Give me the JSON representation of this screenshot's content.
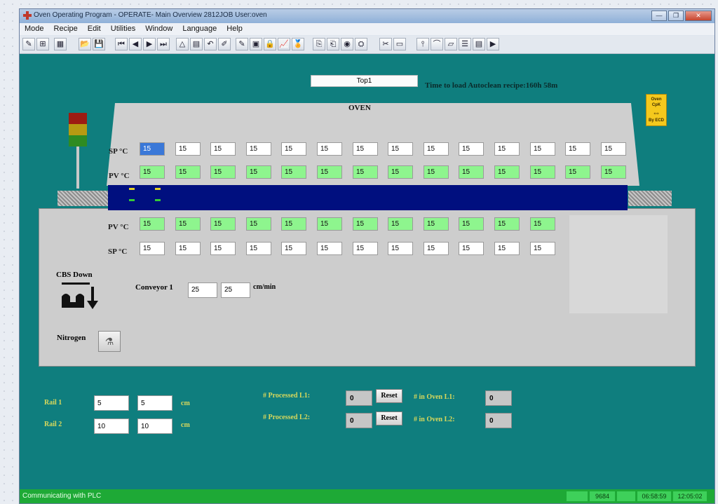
{
  "window": {
    "title": "Oven Operating Program - OPERATE- Main Overview 2812JOB User:oven",
    "buttons": [
      "—",
      "❐",
      "✕"
    ]
  },
  "menu": [
    "Mode",
    "Recipe",
    "Edit",
    "Utilities",
    "Window",
    "Language",
    "Help"
  ],
  "toolbar": {
    "icons": [
      "edit-icon",
      "grid-icon",
      "zones-icon",
      "open-folder-icon",
      "save-icon",
      "first-icon",
      "prev-icon",
      "next-icon",
      "last-icon",
      "triangle-icon",
      "profile-icon",
      "undo-icon",
      "draw-icon",
      "pen-icon",
      "box-icon",
      "lock-icon",
      "graph-icon",
      "certificate-icon",
      "copy-icon",
      "paste-icon",
      "wheel-icon",
      "camera-icon",
      "cut-icon",
      "window-icon",
      "probe-icon",
      "measure-icon",
      "tape-icon",
      "list-icon",
      "monitor-icon",
      "play-icon"
    ],
    "glyphs": [
      "✎",
      "⊞",
      "▦",
      "📂",
      "💾",
      "⏮",
      "◀",
      "▶",
      "⏭",
      "△",
      "▤",
      "↶",
      "✐",
      "✎",
      "▣",
      "🔒",
      "📈",
      "🏅",
      "⎘",
      "⎗",
      "◉",
      "⛭",
      "✂",
      "▭",
      "⫯",
      "⌒",
      "▱",
      "☰",
      "▤",
      "▶"
    ]
  },
  "header": {
    "top_field": "Top1",
    "autoclean": "Time to load Autoclean recipe:160h 58m",
    "cpk_badge": [
      "Oven CpK",
      "⇔",
      "By ECD"
    ]
  },
  "oven": {
    "label": "OVEN",
    "upper_sp_label": "SP °C",
    "upper_pv_label": "PV °C",
    "lower_pv_label": "PV °C",
    "lower_sp_label": "SP °C",
    "upper_sp": [
      "15",
      "15",
      "15",
      "15",
      "15",
      "15",
      "15",
      "15",
      "15",
      "15",
      "15",
      "15",
      "15",
      "15"
    ],
    "upper_pv": [
      "15",
      "15",
      "15",
      "15",
      "15",
      "15",
      "15",
      "15",
      "15",
      "15",
      "15",
      "15",
      "15",
      "15"
    ],
    "lower_pv": [
      "15",
      "15",
      "15",
      "15",
      "15",
      "15",
      "15",
      "15",
      "15",
      "15",
      "15",
      "15"
    ],
    "lower_sp": [
      "15",
      "15",
      "15",
      "15",
      "15",
      "15",
      "15",
      "15",
      "15",
      "15",
      "15",
      "15"
    ]
  },
  "controls": {
    "cbs_label": "CBS Down",
    "conveyor_label": "Conveyor 1",
    "conveyor_values": [
      "25",
      "25"
    ],
    "conveyor_unit": "cm/min",
    "nitrogen_label": "Nitrogen",
    "nitrogen_glyph": "⚗"
  },
  "rails": [
    {
      "label": "Rail 1",
      "values": [
        "5",
        "5"
      ],
      "unit": "cm"
    },
    {
      "label": "Rail 2",
      "values": [
        "10",
        "10"
      ],
      "unit": "cm"
    }
  ],
  "processed": [
    {
      "label": "# Processed L1:",
      "value": "0",
      "reset": "Reset",
      "oven_label": "# in Oven L1:",
      "oven_value": "0"
    },
    {
      "label": "# Processed L2:",
      "value": "0",
      "reset": "Reset",
      "oven_label": "# in Oven L2:",
      "oven_value": "0"
    }
  ],
  "status": {
    "text": "Communicating with PLC",
    "fields": [
      "",
      "9684",
      "",
      "06:58:59",
      "12:05:02"
    ]
  },
  "colors": {
    "workarea": "#0f7e7e",
    "pv_green": "#8ef58e",
    "conveyor_blue": "#000f7f",
    "status_green": "#1ea936"
  }
}
